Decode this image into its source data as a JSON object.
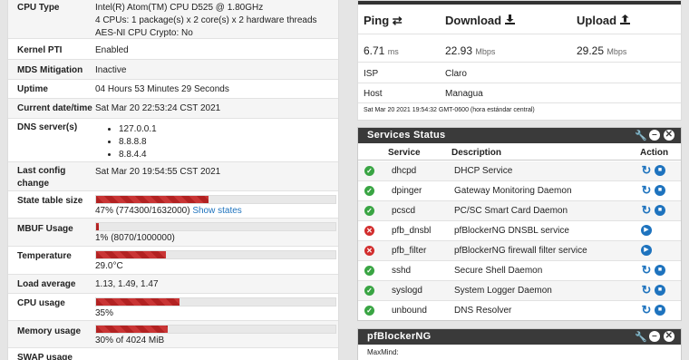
{
  "system": {
    "cpu_type_label": "CPU Type",
    "cpu_type_lines": [
      "Intel(R) Atom(TM) CPU D525 @ 1.80GHz",
      "4 CPUs: 1 package(s) x 2 core(s) x 2 hardware threads",
      "AES-NI CPU Crypto: No"
    ],
    "kernel_pti_label": "Kernel PTI",
    "kernel_pti_value": "Enabled",
    "mds_label": "MDS Mitigation",
    "mds_value": "Inactive",
    "uptime_label": "Uptime",
    "uptime_value": "04 Hours 53 Minutes 29 Seconds",
    "datetime_label": "Current date/time",
    "datetime_value": "Sat Mar 20 22:53:24 CST 2021",
    "dns_label": "DNS server(s)",
    "dns_servers": [
      "127.0.0.1",
      "8.8.8.8",
      "8.8.4.4"
    ],
    "last_config_label": "Last config change",
    "last_config_value": "Sat Mar 20 19:54:55 CST 2021",
    "state_table_label": "State table size",
    "state_table_value": "47% (774300/1632000)",
    "state_table_pct": 47,
    "show_states_link": "Show states",
    "mbuf_label": "MBUF Usage",
    "mbuf_value": "1% (8070/1000000)",
    "mbuf_pct": 1,
    "temp_label": "Temperature",
    "temp_value": "29.0°C",
    "temp_pct": 29,
    "load_label": "Load average",
    "load_value": "1.13, 1.49, 1.47",
    "cpu_usage_label": "CPU usage",
    "cpu_usage_value": "35%",
    "cpu_usage_pct": 35,
    "mem_label": "Memory usage",
    "mem_value": "30% of 4024 MiB",
    "mem_pct": 30,
    "swap_label": "SWAP usage"
  },
  "speedtest": {
    "ping_label": "Ping",
    "download_label": "Download",
    "upload_label": "Upload",
    "ping_value": "6.71",
    "ping_unit": "ms",
    "download_value": "22.93",
    "download_unit": "Mbps",
    "upload_value": "29.25",
    "upload_unit": "Mbps",
    "isp_label": "ISP",
    "isp_value": "Claro",
    "host_label": "Host",
    "host_value": "Managua",
    "timestamp": "Sat Mar 20 2021 19:54:32 GMT-0600 (hora estándar central)"
  },
  "services": {
    "title": "Services Status",
    "col_service": "Service",
    "col_description": "Description",
    "col_action": "Action",
    "rows": [
      {
        "name": "dhcpd",
        "desc": "DHCP Service",
        "running": true
      },
      {
        "name": "dpinger",
        "desc": "Gateway Monitoring Daemon",
        "running": true
      },
      {
        "name": "pcscd",
        "desc": "PC/SC Smart Card Daemon",
        "running": true
      },
      {
        "name": "pfb_dnsbl",
        "desc": "pfBlockerNG DNSBL service",
        "running": false
      },
      {
        "name": "pfb_filter",
        "desc": "pfBlockerNG firewall filter service",
        "running": false
      },
      {
        "name": "sshd",
        "desc": "Secure Shell Daemon",
        "running": true
      },
      {
        "name": "syslogd",
        "desc": "System Logger Daemon",
        "running": true
      },
      {
        "name": "unbound",
        "desc": "DNS Resolver",
        "running": true
      }
    ]
  },
  "pfblocker": {
    "title": "pfBlockerNG",
    "maxmind_label": "MaxMind:"
  },
  "icons": {
    "ping": "swap-arrows-icon",
    "download": "download-icon",
    "upload": "upload-icon",
    "wrench": "wrench-icon",
    "minimize": "minimize-icon",
    "close": "close-icon",
    "ok": "check-circle-icon",
    "stopped": "x-circle-icon",
    "restart": "restart-icon",
    "stop": "stop-icon",
    "start": "play-icon"
  },
  "colors": {
    "bar_fill": "#b22222",
    "panel_header": "#3a3a3a",
    "ok": "#3aa544",
    "stopped": "#d22e2e",
    "link": "#1e73be"
  }
}
